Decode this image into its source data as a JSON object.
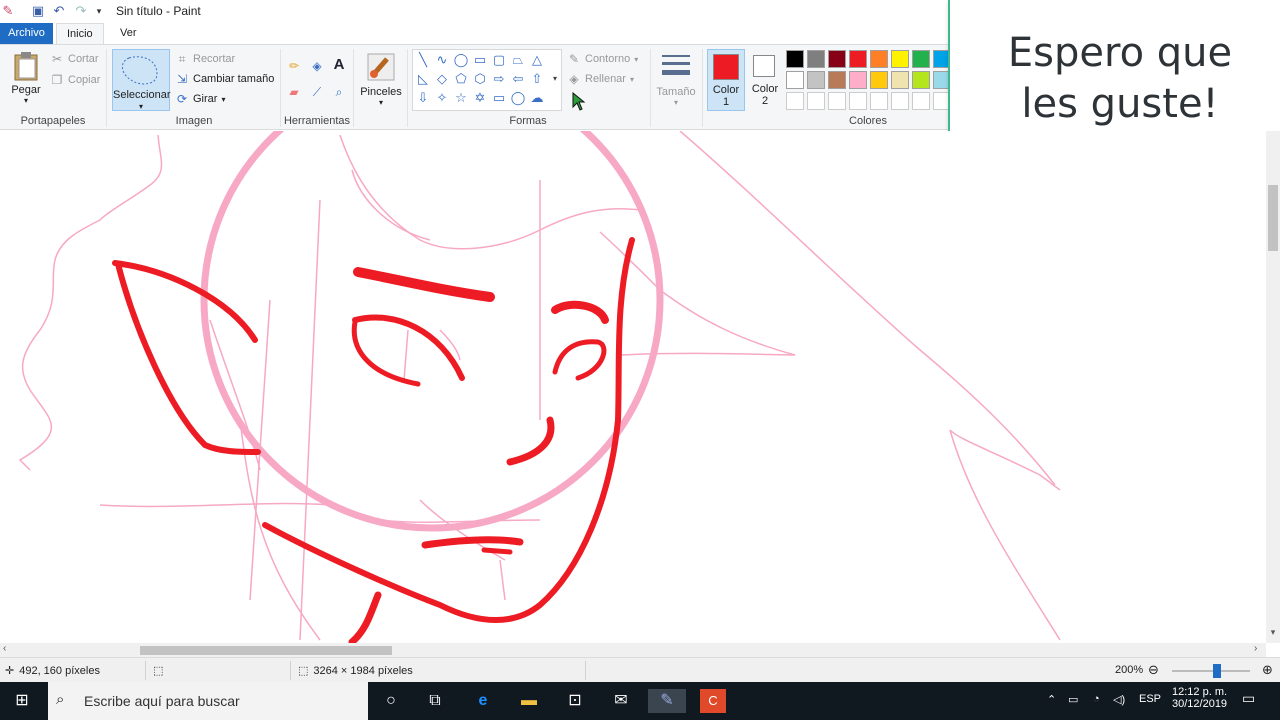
{
  "window": {
    "title": "Sin título - Paint"
  },
  "tabs": {
    "file": "Archivo",
    "home": "Inicio",
    "view": "Ver"
  },
  "ribbon": {
    "clipboard": {
      "paste": "Pegar",
      "cut": "Cortar",
      "copy": "Copiar",
      "label": "Portapapeles"
    },
    "image": {
      "select": "Seleccionar",
      "crop": "Recortar",
      "resize": "Cambiar tamaño",
      "rotate": "Girar",
      "label": "Imagen"
    },
    "tools": {
      "label": "Herramientas"
    },
    "brushes": {
      "label": "Pinceles"
    },
    "shapes": {
      "outline": "Contorno",
      "fill": "Rellenar",
      "label": "Formas"
    },
    "size": {
      "label": "Tamaño"
    },
    "colors": {
      "color1": "Color",
      "color1_num": "1",
      "color2": "Color",
      "color2_num": "2",
      "label": "Colores",
      "color1_value": "#ed1c24",
      "color2_value": "#ffffff",
      "palette_row1": [
        "#000000",
        "#7f7f7f",
        "#880015",
        "#ed1c24",
        "#ff7f27",
        "#fff200",
        "#22b14c",
        "#00a2e8"
      ],
      "palette_row2": [
        "#ffffff",
        "#c3c3c3",
        "#b97a57",
        "#ffaec9",
        "#ffc90e",
        "#efe4b0",
        "#b5e61d",
        "#99d9ea"
      ]
    }
  },
  "callout": {
    "line1": "Espero que",
    "line2": "les guste!"
  },
  "status": {
    "cursor_pos": "492, 160 píxeles",
    "dimensions": "3264 × 1984 píxeles",
    "zoom": "200%"
  },
  "taskbar": {
    "search_placeholder": "Escribe aquí para buscar",
    "lang": "ESP",
    "time": "12:12 p. m.",
    "date": "30/12/2019"
  }
}
